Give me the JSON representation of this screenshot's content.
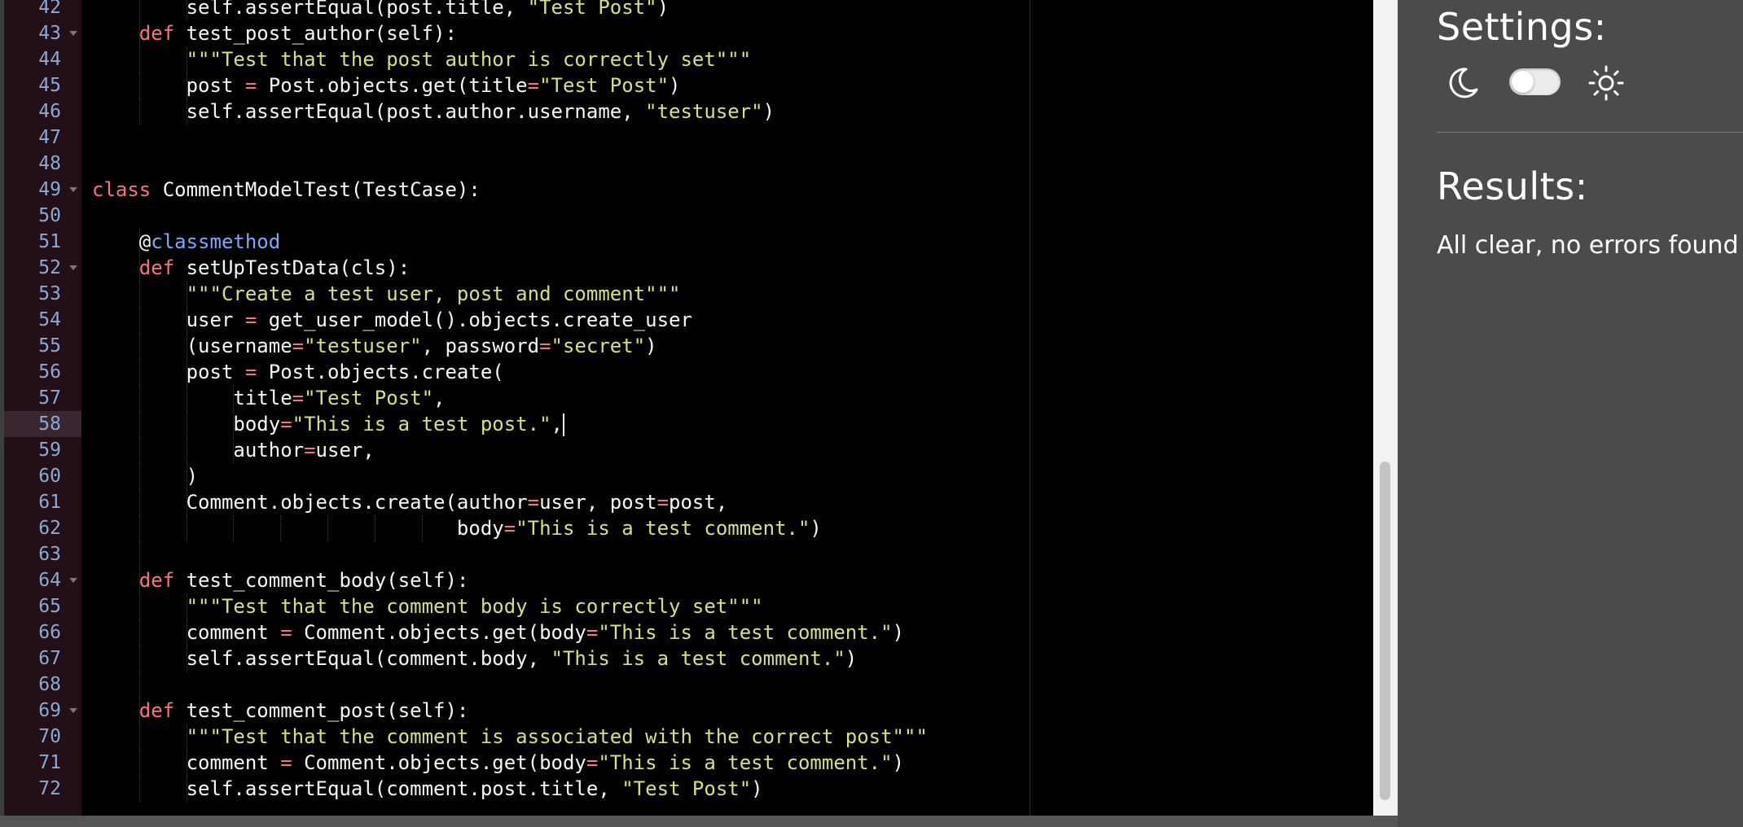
{
  "editor": {
    "active_line": 58,
    "lines": [
      {
        "n": 42,
        "fold": false,
        "guides": [
          1,
          2
        ],
        "tokens": [
          {
            "t": "        self.assertEqual(post.title, ",
            "c": "plain"
          },
          {
            "t": "\"Test Post\"",
            "c": "string"
          },
          {
            "t": ")",
            "c": "plain"
          }
        ]
      },
      {
        "n": 43,
        "fold": true,
        "guides": [
          1
        ],
        "tokens": [
          {
            "t": "    ",
            "c": "plain"
          },
          {
            "t": "def",
            "c": "keyword"
          },
          {
            "t": " test_post_author(self):",
            "c": "plain"
          }
        ]
      },
      {
        "n": 44,
        "fold": false,
        "guides": [
          1,
          2
        ],
        "tokens": [
          {
            "t": "        ",
            "c": "plain"
          },
          {
            "t": "\"\"\"Test that the post author is correctly set\"\"\"",
            "c": "string"
          }
        ]
      },
      {
        "n": 45,
        "fold": false,
        "guides": [
          1,
          2
        ],
        "tokens": [
          {
            "t": "        post ",
            "c": "plain"
          },
          {
            "t": "=",
            "c": "op"
          },
          {
            "t": " Post.objects.get(title",
            "c": "plain"
          },
          {
            "t": "=",
            "c": "op"
          },
          {
            "t": "\"Test Post\"",
            "c": "string"
          },
          {
            "t": ")",
            "c": "plain"
          }
        ]
      },
      {
        "n": 46,
        "fold": false,
        "guides": [
          1,
          2
        ],
        "tokens": [
          {
            "t": "        self.assertEqual(post.author.username, ",
            "c": "plain"
          },
          {
            "t": "\"testuser\"",
            "c": "string"
          },
          {
            "t": ")",
            "c": "plain"
          }
        ]
      },
      {
        "n": 47,
        "fold": false,
        "guides": [],
        "tokens": []
      },
      {
        "n": 48,
        "fold": false,
        "guides": [],
        "tokens": []
      },
      {
        "n": 49,
        "fold": true,
        "guides": [],
        "tokens": [
          {
            "t": "class",
            "c": "keyword"
          },
          {
            "t": " CommentModelTest(TestCase):",
            "c": "plain"
          }
        ]
      },
      {
        "n": 50,
        "fold": false,
        "guides": [],
        "tokens": []
      },
      {
        "n": 51,
        "fold": false,
        "guides": [
          1
        ],
        "tokens": [
          {
            "t": "    @",
            "c": "plain"
          },
          {
            "t": "classmethod",
            "c": "deco"
          }
        ]
      },
      {
        "n": 52,
        "fold": true,
        "guides": [
          1
        ],
        "tokens": [
          {
            "t": "    ",
            "c": "plain"
          },
          {
            "t": "def",
            "c": "keyword"
          },
          {
            "t": " setUpTestData(cls):",
            "c": "plain"
          }
        ]
      },
      {
        "n": 53,
        "fold": false,
        "guides": [
          1,
          2
        ],
        "tokens": [
          {
            "t": "        ",
            "c": "plain"
          },
          {
            "t": "\"\"\"Create a test user, post and comment\"\"\"",
            "c": "string"
          }
        ]
      },
      {
        "n": 54,
        "fold": false,
        "guides": [
          1,
          2
        ],
        "tokens": [
          {
            "t": "        user ",
            "c": "plain"
          },
          {
            "t": "=",
            "c": "op"
          },
          {
            "t": " get_user_model().objects.create_user",
            "c": "plain"
          }
        ]
      },
      {
        "n": 55,
        "fold": false,
        "guides": [
          1,
          2
        ],
        "tokens": [
          {
            "t": "        (username",
            "c": "plain"
          },
          {
            "t": "=",
            "c": "op"
          },
          {
            "t": "\"testuser\"",
            "c": "string"
          },
          {
            "t": ", password",
            "c": "plain"
          },
          {
            "t": "=",
            "c": "op"
          },
          {
            "t": "\"secret\"",
            "c": "string"
          },
          {
            "t": ")",
            "c": "plain"
          }
        ]
      },
      {
        "n": 56,
        "fold": false,
        "guides": [
          1,
          2
        ],
        "tokens": [
          {
            "t": "        post ",
            "c": "plain"
          },
          {
            "t": "=",
            "c": "op"
          },
          {
            "t": " Post.objects.create(",
            "c": "plain"
          }
        ]
      },
      {
        "n": 57,
        "fold": false,
        "guides": [
          1,
          2,
          3
        ],
        "tokens": [
          {
            "t": "            title",
            "c": "plain"
          },
          {
            "t": "=",
            "c": "op"
          },
          {
            "t": "\"Test Post\"",
            "c": "string"
          },
          {
            "t": ",",
            "c": "plain"
          }
        ]
      },
      {
        "n": 58,
        "fold": false,
        "guides": [
          1,
          2,
          3
        ],
        "cursor": true,
        "tokens": [
          {
            "t": "            body",
            "c": "plain"
          },
          {
            "t": "=",
            "c": "op"
          },
          {
            "t": "\"This is a test post.\"",
            "c": "string"
          },
          {
            "t": ",",
            "c": "plain"
          }
        ]
      },
      {
        "n": 59,
        "fold": false,
        "guides": [
          1,
          2,
          3
        ],
        "tokens": [
          {
            "t": "            author",
            "c": "plain"
          },
          {
            "t": "=",
            "c": "op"
          },
          {
            "t": "user,",
            "c": "plain"
          }
        ]
      },
      {
        "n": 60,
        "fold": false,
        "guides": [
          1,
          2
        ],
        "tokens": [
          {
            "t": "        )",
            "c": "plain"
          }
        ]
      },
      {
        "n": 61,
        "fold": false,
        "guides": [
          1,
          2
        ],
        "tokens": [
          {
            "t": "        Comment.objects.create(author",
            "c": "plain"
          },
          {
            "t": "=",
            "c": "op"
          },
          {
            "t": "user, post",
            "c": "plain"
          },
          {
            "t": "=",
            "c": "op"
          },
          {
            "t": "post,",
            "c": "plain"
          }
        ]
      },
      {
        "n": 62,
        "fold": false,
        "guides": [
          1,
          2,
          3,
          4,
          5,
          6,
          7
        ],
        "tokens": [
          {
            "t": "                               body",
            "c": "plain"
          },
          {
            "t": "=",
            "c": "op"
          },
          {
            "t": "\"This is a test comment.\"",
            "c": "string"
          },
          {
            "t": ")",
            "c": "plain"
          }
        ]
      },
      {
        "n": 63,
        "fold": false,
        "guides": [
          1
        ],
        "tokens": []
      },
      {
        "n": 64,
        "fold": true,
        "guides": [
          1
        ],
        "tokens": [
          {
            "t": "    ",
            "c": "plain"
          },
          {
            "t": "def",
            "c": "keyword"
          },
          {
            "t": " test_comment_body(self):",
            "c": "plain"
          }
        ]
      },
      {
        "n": 65,
        "fold": false,
        "guides": [
          1,
          2
        ],
        "tokens": [
          {
            "t": "        ",
            "c": "plain"
          },
          {
            "t": "\"\"\"Test that the comment body is correctly set\"\"\"",
            "c": "string"
          }
        ]
      },
      {
        "n": 66,
        "fold": false,
        "guides": [
          1,
          2
        ],
        "tokens": [
          {
            "t": "        comment ",
            "c": "plain"
          },
          {
            "t": "=",
            "c": "op"
          },
          {
            "t": " Comment.objects.get(body",
            "c": "plain"
          },
          {
            "t": "=",
            "c": "op"
          },
          {
            "t": "\"This is a test comment.\"",
            "c": "string"
          },
          {
            "t": ")",
            "c": "plain"
          }
        ]
      },
      {
        "n": 67,
        "fold": false,
        "guides": [
          1,
          2
        ],
        "tokens": [
          {
            "t": "        self.assertEqual(comment.body, ",
            "c": "plain"
          },
          {
            "t": "\"This is a test comment.\"",
            "c": "string"
          },
          {
            "t": ")",
            "c": "plain"
          }
        ]
      },
      {
        "n": 68,
        "fold": false,
        "guides": [
          1
        ],
        "tokens": []
      },
      {
        "n": 69,
        "fold": true,
        "guides": [
          1
        ],
        "tokens": [
          {
            "t": "    ",
            "c": "plain"
          },
          {
            "t": "def",
            "c": "keyword"
          },
          {
            "t": " test_comment_post(self):",
            "c": "plain"
          }
        ]
      },
      {
        "n": 70,
        "fold": false,
        "guides": [
          1,
          2
        ],
        "tokens": [
          {
            "t": "        ",
            "c": "plain"
          },
          {
            "t": "\"\"\"Test that the comment is associated with the correct post\"\"\"",
            "c": "string"
          }
        ]
      },
      {
        "n": 71,
        "fold": false,
        "guides": [
          1,
          2
        ],
        "tokens": [
          {
            "t": "        comment ",
            "c": "plain"
          },
          {
            "t": "=",
            "c": "op"
          },
          {
            "t": " Comment.objects.get(body",
            "c": "plain"
          },
          {
            "t": "=",
            "c": "op"
          },
          {
            "t": "\"This is a test comment.\"",
            "c": "string"
          },
          {
            "t": ")",
            "c": "plain"
          }
        ]
      },
      {
        "n": 72,
        "fold": false,
        "guides": [
          1,
          2
        ],
        "tokens": [
          {
            "t": "        self.assertEqual(comment.post.title, ",
            "c": "plain"
          },
          {
            "t": "\"Test Post\"",
            "c": "string"
          },
          {
            "t": ")",
            "c": "plain"
          }
        ]
      }
    ]
  },
  "panel": {
    "settings_title": "Settings:",
    "theme_toggle": {
      "dark_icon": "moon-icon",
      "light_icon": "sun-icon",
      "state": "off"
    },
    "results_title": "Results:",
    "results_text": "All clear, no errors found"
  }
}
